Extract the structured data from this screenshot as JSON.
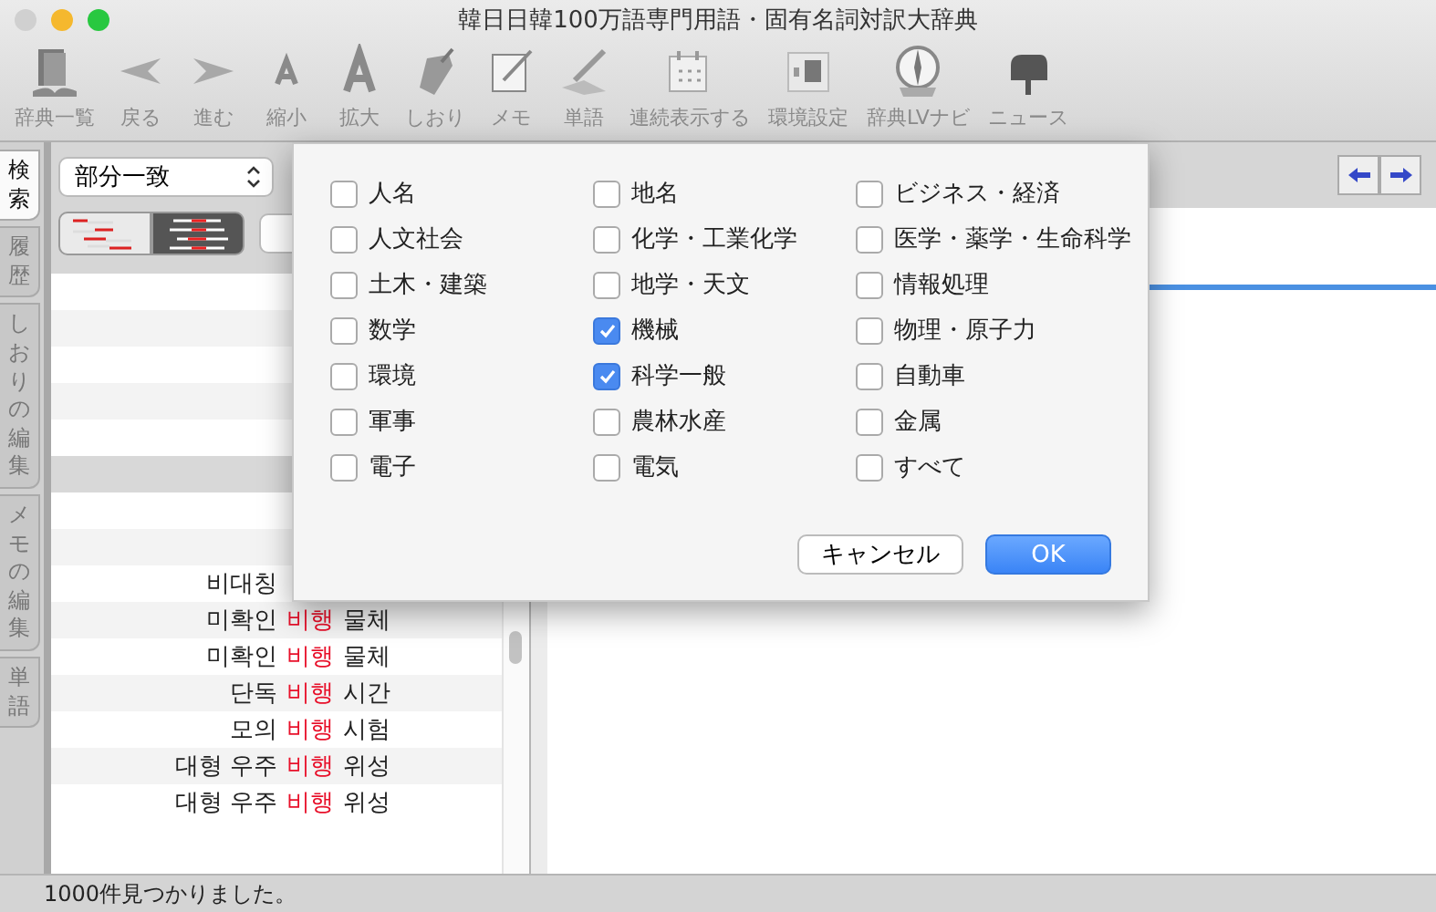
{
  "window": {
    "title": "韓日日韓100万語専門用語・固有名詞対訳大辞典"
  },
  "toolbar": [
    {
      "label": "辞典一覧"
    },
    {
      "label": "戻る"
    },
    {
      "label": "進む"
    },
    {
      "label": "縮小"
    },
    {
      "label": "拡大"
    },
    {
      "label": "しおり"
    },
    {
      "label": "メモ"
    },
    {
      "label": "単語"
    },
    {
      "label": "連続表示する"
    },
    {
      "label": "環境設定"
    },
    {
      "label": "辞典LVナビ"
    },
    {
      "label": "ニュース"
    }
  ],
  "side_tabs": [
    {
      "label": "検索",
      "selected": true
    },
    {
      "label": "履歴",
      "selected": false
    },
    {
      "label": "しおりの編集",
      "selected": false
    },
    {
      "label": "メモの編集",
      "selected": false
    },
    {
      "label": "単語",
      "selected": false
    }
  ],
  "search": {
    "match_mode": "部分一致",
    "view_modes": [
      {
        "selected": false
      },
      {
        "selected": true
      }
    ]
  },
  "results": [
    {
      "before": "비대칭"
    },
    {
      "before": "미확인",
      "match": "비행",
      "after": "물체"
    },
    {
      "before": "미확인",
      "match": "비행",
      "after": "물체"
    },
    {
      "before": "단독",
      "match": "비행",
      "after": "시간"
    },
    {
      "before": "모의",
      "match": "비행",
      "after": "시험"
    },
    {
      "before": "대형 우주",
      "match": "비행",
      "after": "위성"
    },
    {
      "before": "대형 우주",
      "match": "비행",
      "after": "위성"
    }
  ],
  "dialog": {
    "categories": [
      [
        {
          "label": "人名",
          "checked": false
        },
        {
          "label": "人文社会",
          "checked": false
        },
        {
          "label": "土木・建築",
          "checked": false
        },
        {
          "label": "数学",
          "checked": false
        },
        {
          "label": "環境",
          "checked": false
        },
        {
          "label": "軍事",
          "checked": false
        },
        {
          "label": "電子",
          "checked": false
        }
      ],
      [
        {
          "label": "地名",
          "checked": false
        },
        {
          "label": "化学・工業化学",
          "checked": false
        },
        {
          "label": "地学・天文",
          "checked": false
        },
        {
          "label": "機械",
          "checked": true
        },
        {
          "label": "科学一般",
          "checked": true
        },
        {
          "label": "農林水産",
          "checked": false
        },
        {
          "label": "電気",
          "checked": false
        }
      ],
      [
        {
          "label": "ビジネス・経済",
          "checked": false
        },
        {
          "label": "医学・薬学・生命科学",
          "checked": false
        },
        {
          "label": "情報処理",
          "checked": false
        },
        {
          "label": "物理・原子力",
          "checked": false
        },
        {
          "label": "自動車",
          "checked": false
        },
        {
          "label": "金属",
          "checked": false
        },
        {
          "label": "すべて",
          "checked": false
        }
      ]
    ],
    "cancel": "キャンセル",
    "ok": "OK"
  },
  "status_bar": "1000件見つかりました。"
}
